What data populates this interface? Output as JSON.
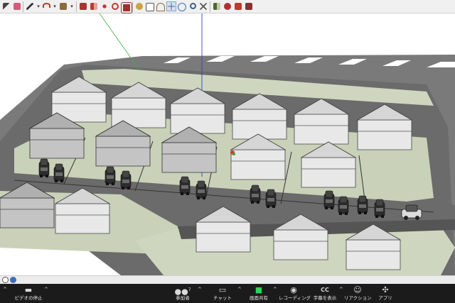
{
  "toolbar": {
    "tools": [
      {
        "name": "select-tool-icon",
        "color": "#444444"
      },
      {
        "name": "eraser-tool-icon",
        "color": "#d45a7a"
      },
      {
        "name": "pencil-tool-icon",
        "color": "#333333"
      },
      {
        "name": "arc-tool-icon",
        "color": "#c0392b"
      },
      {
        "name": "rectangle-tool-icon",
        "color": "#8a6a3d"
      },
      {
        "name": "push-pull-tool-icon",
        "color": "#b03030"
      },
      {
        "name": "follow-me-tool-icon",
        "color": "#c0392b"
      },
      {
        "name": "move-tool-icon",
        "color": "#d03030"
      },
      {
        "name": "rotate-tool-icon",
        "color": "#c0392b"
      },
      {
        "name": "offset-tool-icon",
        "color": "#a03030"
      },
      {
        "name": "tape-measure-icon",
        "color": "#9a7a3a"
      },
      {
        "name": "dimension-tool-icon",
        "color": "#555555"
      },
      {
        "name": "protractor-tool-icon",
        "color": "#8a6a3d"
      },
      {
        "name": "text-tool-icon",
        "color": "#333333"
      },
      {
        "name": "axes-tool-icon",
        "color": "#c0392b"
      },
      {
        "name": "section-plane-icon",
        "color": "#d07030"
      },
      {
        "name": "orbit-tool-icon",
        "color": "#3b6fb6"
      },
      {
        "name": "pan-tool-icon",
        "color": "#555555"
      },
      {
        "name": "zoom-tool-icon",
        "color": "#3b5f8a"
      },
      {
        "name": "zoom-extents-icon",
        "color": "#555555"
      },
      {
        "name": "components-icon",
        "color": "#4a6a2a"
      },
      {
        "name": "materials-icon",
        "color": "#b03030"
      },
      {
        "name": "warehouse-icon",
        "color": "#c0392b"
      },
      {
        "name": "extension-icon",
        "color": "#8a3030"
      }
    ]
  },
  "zoom": {
    "buttons": [
      {
        "label": "ビデオの停止",
        "icon": "▬"
      },
      {
        "label": "参加者",
        "icon": "●●",
        "count": "7"
      },
      {
        "label": "チャット",
        "icon": "▭"
      },
      {
        "label": "画面共有",
        "icon": "■"
      },
      {
        "label": "レコーディング",
        "icon": "◉"
      },
      {
        "label": "字幕を表示",
        "icon": "CC"
      },
      {
        "label": "リアクション",
        "icon": "☺"
      },
      {
        "label": "アプリ",
        "icon": "✣"
      }
    ],
    "share_color": "#23d959"
  }
}
